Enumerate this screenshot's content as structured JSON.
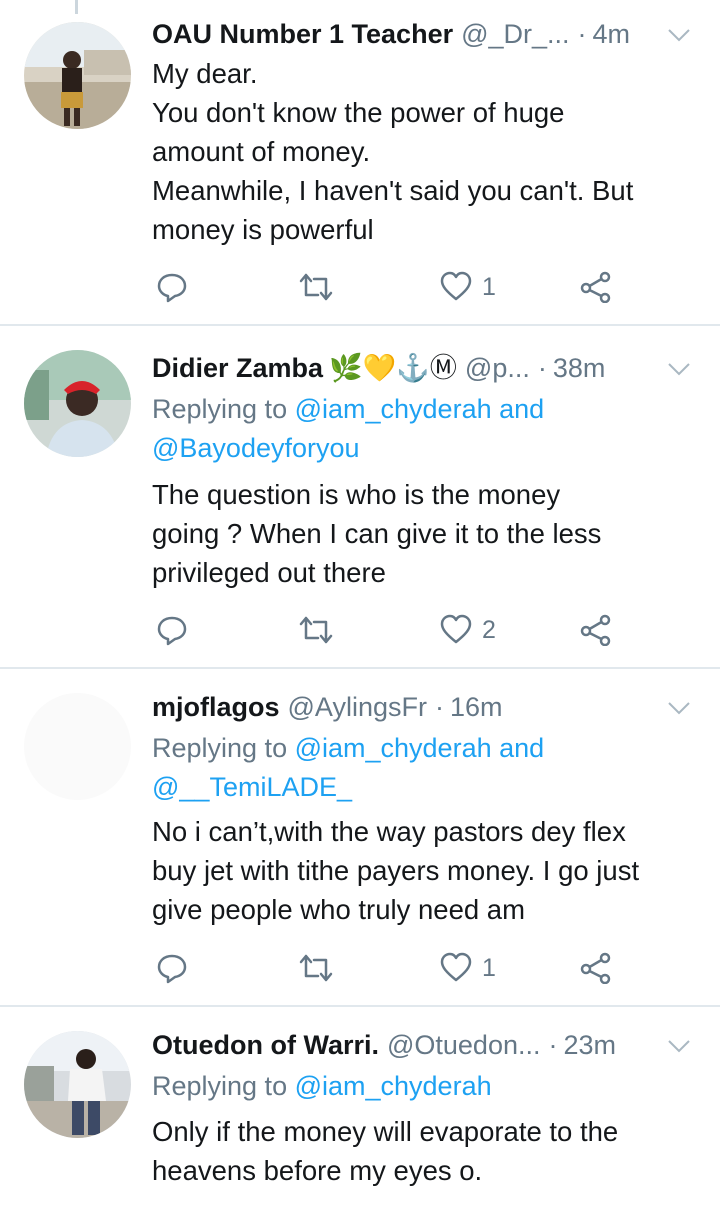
{
  "tweets": [
    {
      "name": "OAU Number 1 Teacher",
      "emoji": "",
      "handle": "@_Dr_...",
      "time": "4m",
      "reply_prefix": "",
      "reply_mentions": "",
      "reply_mentions2": "",
      "lines": [
        "My dear.",
        "You don't know the power of huge",
        "amount of money.",
        "Meanwhile, I haven't said you can't. But",
        "money is powerful"
      ],
      "likes": "1"
    },
    {
      "name": "Didier Zamba",
      "emoji": "🌿💛⚓Ⓜ",
      "handle": "@p...",
      "time": "38m",
      "reply_prefix": "Replying to ",
      "reply_mentions": "@iam_chyderah and",
      "reply_mentions2": "@Bayodeyforyou",
      "lines": [
        "The question is who is the money",
        "going ? When I can give it to the less",
        "privileged  out there"
      ],
      "likes": "2"
    },
    {
      "name": "mjoflagos",
      "emoji": "",
      "handle": "@AylingsFr",
      "time": "16m",
      "reply_prefix": "Replying to ",
      "reply_mentions": "@iam_chyderah and",
      "reply_mentions2": "@__TemiLADE_",
      "lines": [
        "No i can’t,with the way pastors dey flex",
        "buy jet with tithe payers money. I go just",
        "give people who truly need am"
      ],
      "likes": "1"
    },
    {
      "name": "Otuedon of Warri.",
      "emoji": "",
      "handle": "@Otuedon...",
      "time": "23m",
      "reply_prefix": "Replying to ",
      "reply_mentions": "@iam_chyderah",
      "reply_mentions2": "",
      "lines": [
        "Only if the money will evaporate to the",
        "heavens before my eyes o."
      ],
      "likes": ""
    }
  ],
  "separator": "·",
  "colors": {
    "text": "#14171a",
    "secondary": "#657786",
    "link": "#1da1f2",
    "divider": "#e1e8ed"
  },
  "icons": {
    "reply": "reply-icon",
    "retweet": "retweet-icon",
    "like": "heart-icon",
    "share": "share-icon",
    "menu": "chevron-down-icon"
  }
}
